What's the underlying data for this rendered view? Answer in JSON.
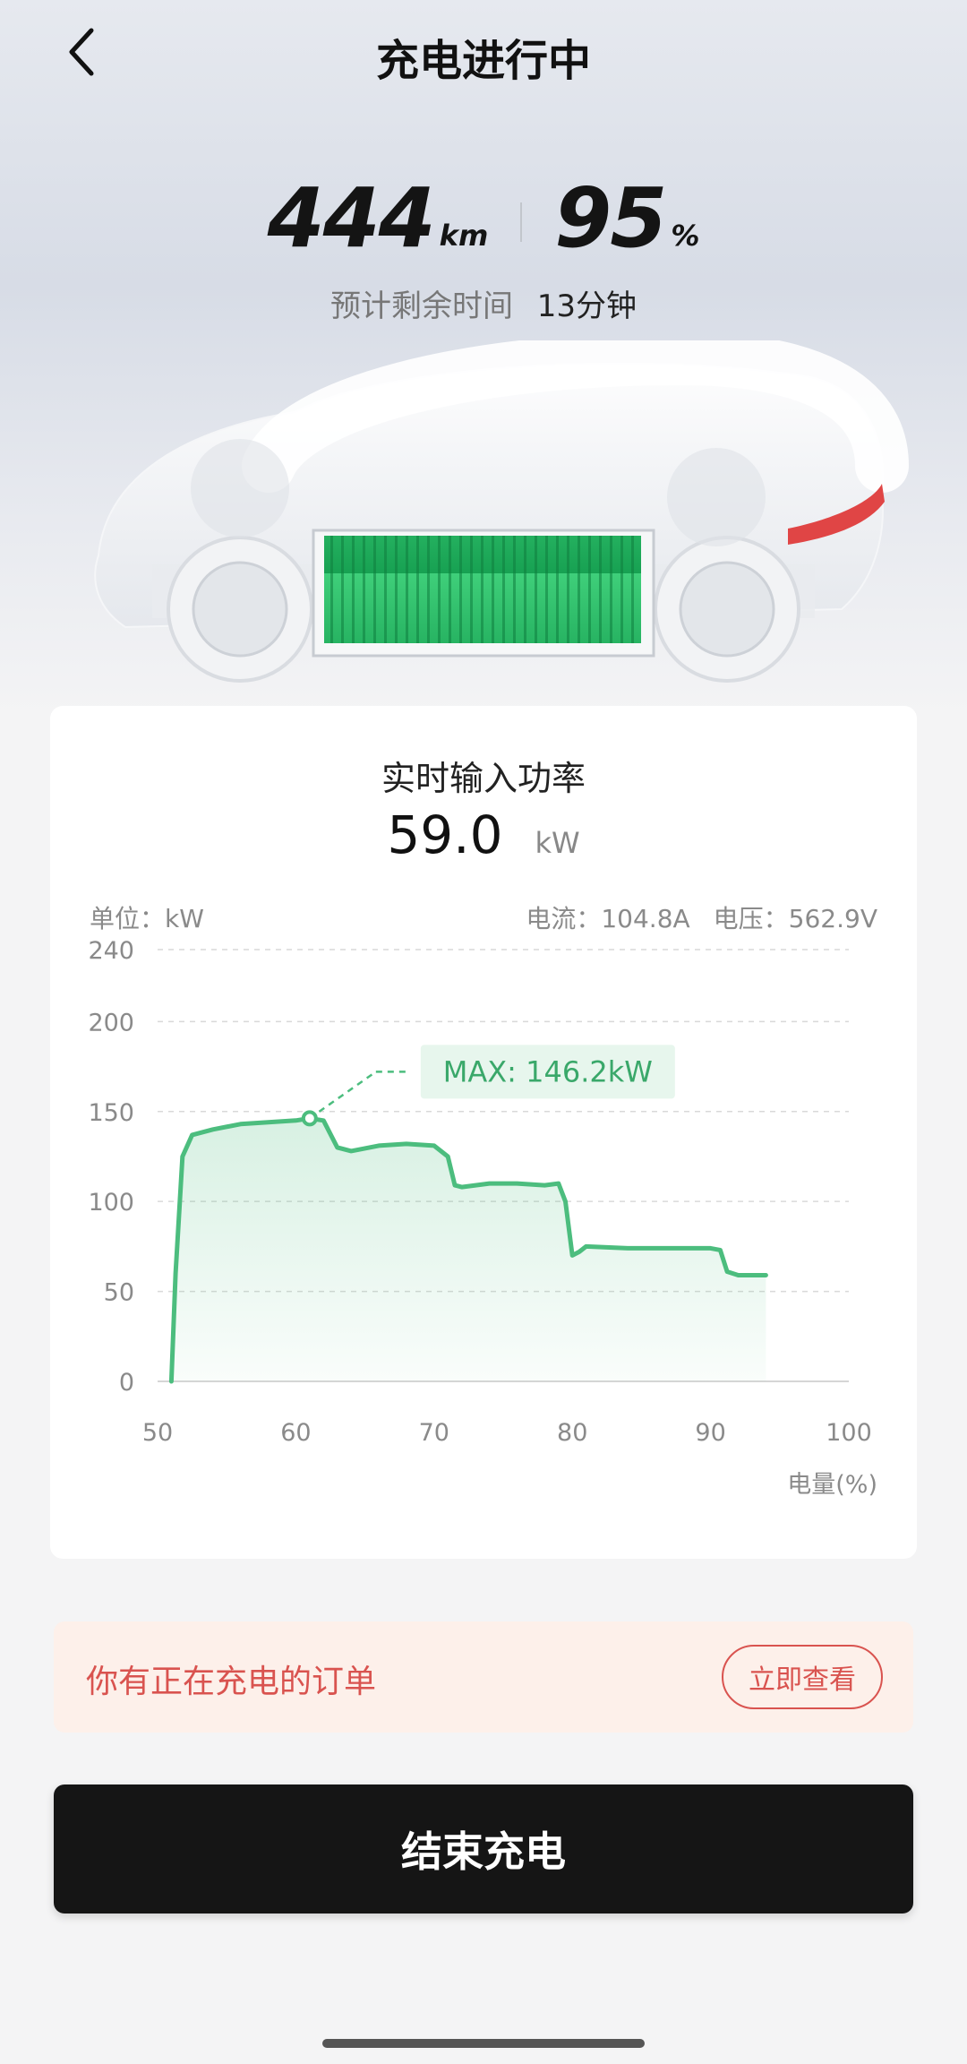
{
  "header": {
    "title": "充电进行中"
  },
  "stats": {
    "range_value": "444",
    "range_unit": "km",
    "battery_value": "95",
    "battery_unit": "%"
  },
  "eta": {
    "label": "预计剩余时间",
    "value": "13分钟"
  },
  "power_card": {
    "title": "实时输入功率",
    "power_value": "59.0",
    "power_unit": "kW",
    "unit_label": "单位：kW",
    "current": "电流：104.8A",
    "voltage": "电压：562.9V"
  },
  "chart_data": {
    "type": "area",
    "xlabel": "电量(%)",
    "ylabel": "",
    "xlim": [
      50,
      100
    ],
    "ylim": [
      0,
      240
    ],
    "x_ticks": [
      50,
      60,
      70,
      80,
      90,
      100
    ],
    "y_ticks": [
      0,
      50,
      100,
      150,
      200,
      240
    ],
    "grid": true,
    "color": "#4cbd7e",
    "annotation": "MAX: 146.2kW",
    "max_point": {
      "x": 61,
      "y": 146.2
    },
    "series": [
      {
        "x": [
          51,
          51.3,
          51.8,
          52.5,
          54,
          56,
          58,
          60,
          61,
          62,
          63,
          64,
          66,
          68,
          70,
          71,
          71.5,
          72,
          74,
          76,
          78,
          79,
          79.5,
          80,
          80.5,
          81,
          84,
          88,
          90,
          90.7,
          91.2,
          92,
          94
        ],
        "y": [
          0,
          60,
          125,
          137,
          140,
          143,
          144,
          145,
          146.2,
          145,
          130,
          128,
          131,
          132,
          131,
          125,
          109,
          108,
          110,
          110,
          109,
          110,
          100,
          70,
          72,
          75,
          74,
          74,
          74,
          73,
          61,
          59,
          59
        ]
      }
    ]
  },
  "notice": {
    "text": "你有正在充电的订单",
    "button": "立即查看"
  },
  "end_button": "结束充电"
}
